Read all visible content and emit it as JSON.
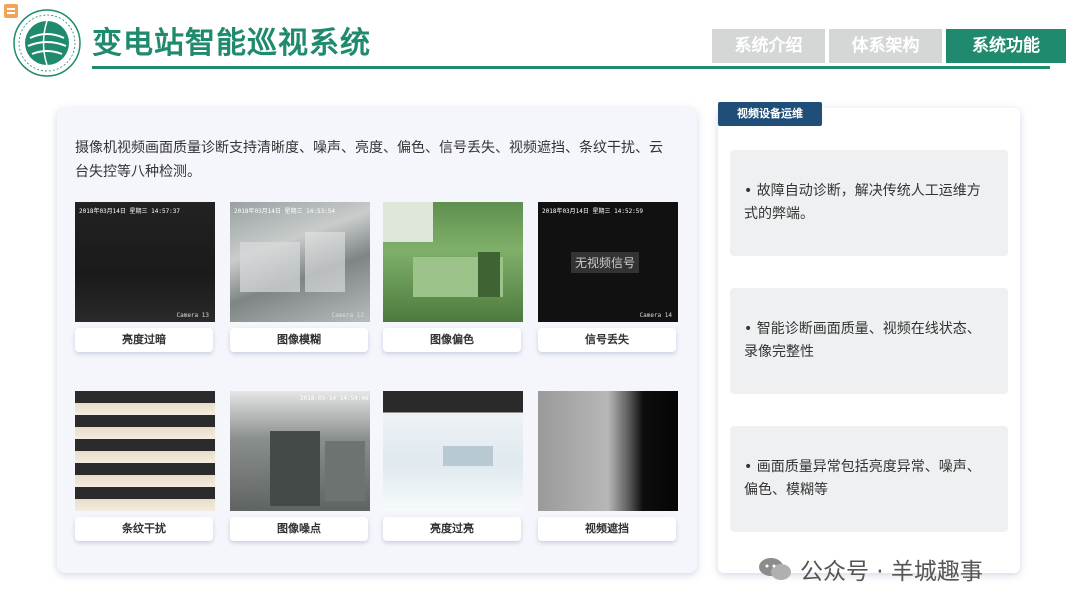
{
  "header": {
    "title": "变电站智能巡视系统",
    "nav_tabs": [
      {
        "label": "系统介绍",
        "active": false
      },
      {
        "label": "体系架构",
        "active": false
      },
      {
        "label": "系统功能",
        "active": true
      }
    ]
  },
  "main": {
    "intro": "摄像机视频画面质量诊断支持清晰度、噪声、亮度、偏色、信号丢失、视频遮挡、条纹干扰、云台失控等八种检测。",
    "cameras": [
      {
        "label": "亮度过暗",
        "timestamp": "2018年03月14日  星期三  14:57:37",
        "camera_id": "Camera 13"
      },
      {
        "label": "图像模糊",
        "timestamp": "2018年03月14日  星期三  14:53:54",
        "camera_id": "Camera 12"
      },
      {
        "label": "图像偏色"
      },
      {
        "label": "信号丢失",
        "timestamp": "2018年03月14日  星期三  14:52:59",
        "camera_id": "Camera 14",
        "overlay": "无视频信号"
      },
      {
        "label": "条纹干扰"
      },
      {
        "label": "图像噪点",
        "timestamp": "2018-03-14  14:54:46"
      },
      {
        "label": "亮度过亮"
      },
      {
        "label": "视频遮挡"
      }
    ]
  },
  "side": {
    "header": "视频设备运维",
    "cards": [
      "• 故障自动诊断，解决传统人工运维方式的弊端。",
      "• 智能诊断画面质量、视频在线状态、录像完整性",
      "• 画面质量异常包括亮度异常、噪声、偏色、模糊等"
    ]
  },
  "watermark": "公众号 · 羊城趣事",
  "colors": {
    "brand_green": "#1f8a6d",
    "nav_inactive": "#d5d7d6",
    "side_header": "#1f4e79"
  }
}
